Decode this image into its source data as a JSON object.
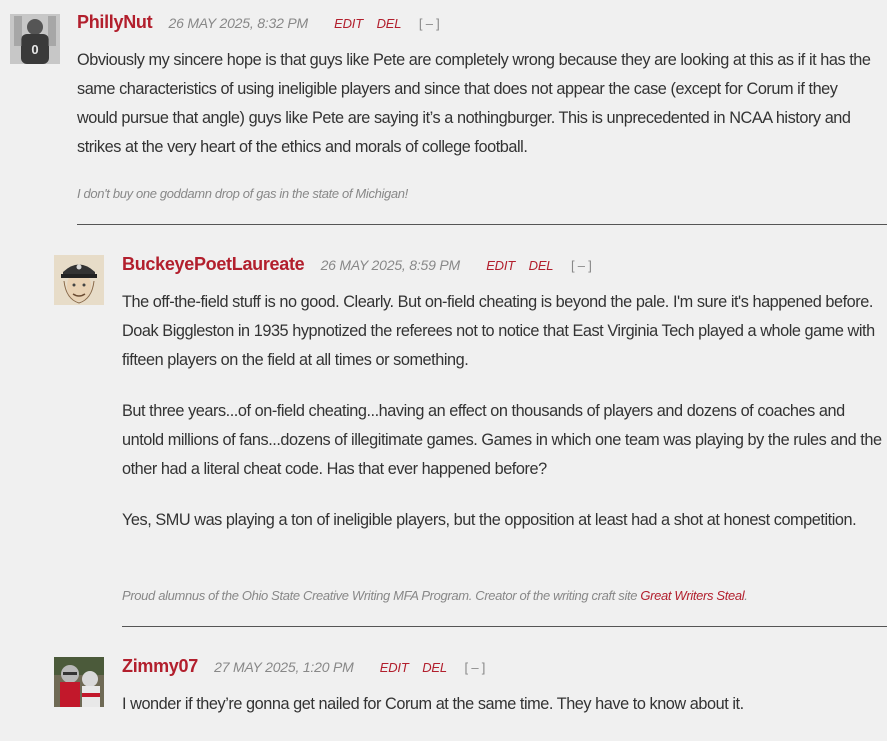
{
  "comments": [
    {
      "author": "PhillyNut",
      "date": "26 MAY 2025, 8:32 PM",
      "edit": "EDIT",
      "del": "DEL",
      "toggle": "[ – ]",
      "avatar_icon": "helmet-avatar-icon",
      "paragraphs": [
        "Obviously my sincere hope is that guys like Pete are completely wrong because they are looking at this as if it has the same characteristics of using ineligible players and since that does not appear the case (except for Corum if they would pursue that angle) guys like Pete are saying it’s a nothingburger. This is unprecedented in NCAA history and strikes at the very heart of the ethics and morals of college football."
      ],
      "signature": "I don't buy one goddamn drop of gas in the state of Michigan!"
    },
    {
      "author": "BuckeyePoetLaureate",
      "date": "26 MAY 2025, 8:59 PM",
      "edit": "EDIT",
      "del": "DEL",
      "toggle": "[ – ]",
      "avatar_icon": "poet-avatar-icon",
      "paragraphs": [
        "The off-the-field stuff is no good.  Clearly.  But on-field cheating is beyond the pale.  I'm sure it's happened before.  Doak Biggleston in 1935 hypnotized the referees not to notice that East Virginia Tech played a whole game with fifteen players on the field at all times or something.",
        "But three years...of on-field cheating...having an effect on thousands of players and dozens of coaches and untold millions of fans...dozens of illegitimate games.  Games in which one team was playing by the rules and the other had a literal cheat code.  Has that ever happened before?",
        "Yes, SMU was playing a ton of ineligible players, but the opposition at least had a shot at honest competition."
      ],
      "signature": "Proud alumnus of the Ohio State Creative Writing MFA Program.  Creator of the writing craft site ",
      "signature_link": "Great Writers Steal",
      "signature_end": "."
    },
    {
      "author": "Zimmy07",
      "date": "27 MAY 2025, 1:20 PM",
      "edit": "EDIT",
      "del": "DEL",
      "toggle": "[ – ]",
      "avatar_icon": "football-player-avatar-icon",
      "paragraphs": [
        "I wonder if they’re gonna get nailed for Corum at the same time.  They have to know about it."
      ]
    }
  ],
  "colors": {
    "accent": "#b21f2d",
    "background": "#f0f0f0",
    "text": "#333333",
    "muted": "#888888"
  }
}
